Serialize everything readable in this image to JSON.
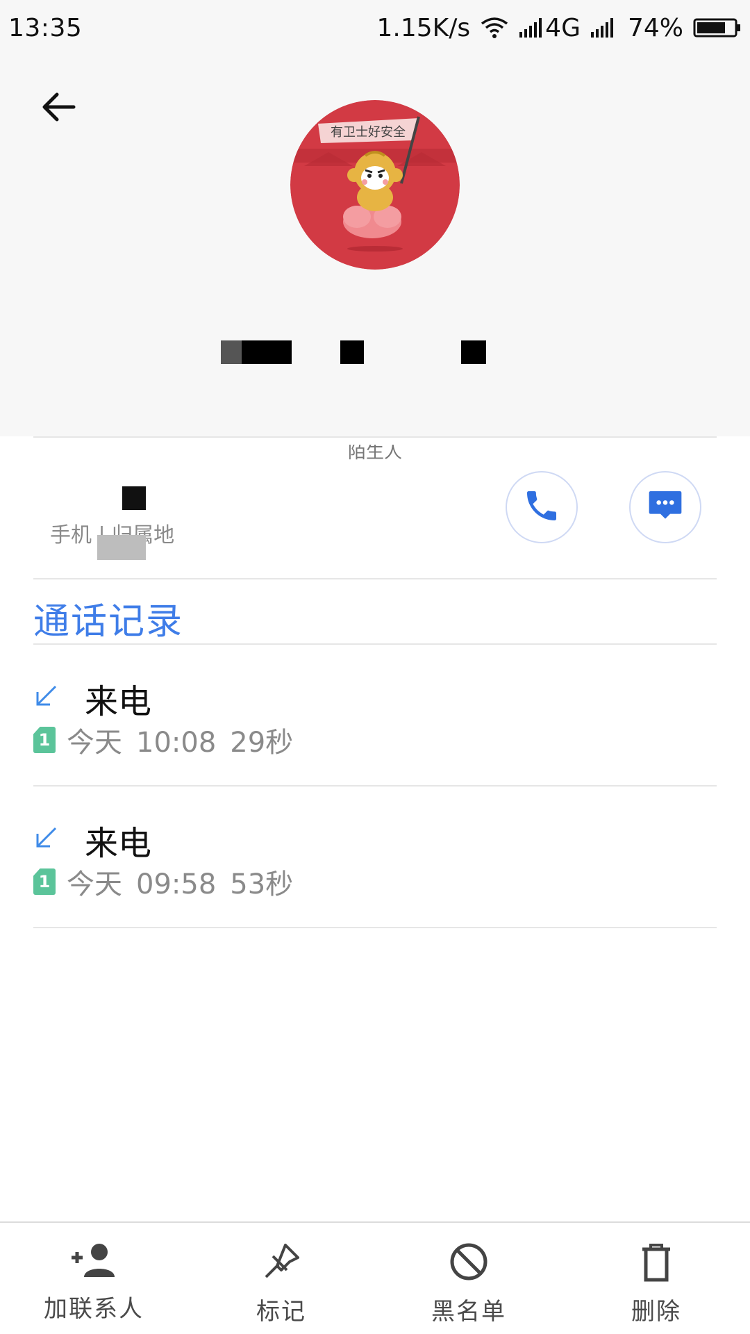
{
  "status_bar": {
    "time": "13:35",
    "speed": "1.15K/s",
    "network": "4G",
    "battery": "74%",
    "icons": [
      "wifi-icon",
      "signal-icon",
      "signal-icon",
      "battery-icon"
    ]
  },
  "header": {
    "back_icon": "back-arrow-icon",
    "avatar_banner_text": "有卫士好安全",
    "location": "陌生人"
  },
  "phone": {
    "label": "手机 | 归属地",
    "call_icon": "phone-icon",
    "message_icon": "message-icon"
  },
  "call_log": {
    "title": "通话记录",
    "entries": [
      {
        "type": "来电",
        "sim": "1",
        "day": "今天",
        "time": "10:08",
        "duration": "29秒"
      },
      {
        "type": "来电",
        "sim": "1",
        "day": "今天",
        "time": "09:58",
        "duration": "53秒"
      }
    ]
  },
  "bottom_bar": {
    "items": [
      {
        "label": "加联系人",
        "icon": "add-contact-icon"
      },
      {
        "label": "标记",
        "icon": "pin-icon"
      },
      {
        "label": "黑名单",
        "icon": "block-icon"
      },
      {
        "label": "删除",
        "icon": "trash-icon"
      }
    ]
  },
  "colors": {
    "accent": "#3f7de8",
    "sim_badge": "#5bc49a",
    "avatar_red": "#d23a44",
    "header_bg": "#f7f7f7"
  }
}
